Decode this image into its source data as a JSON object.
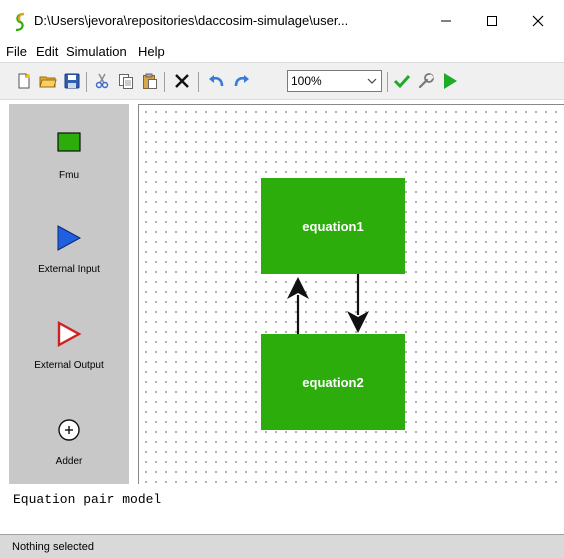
{
  "window": {
    "title": "D:\\Users\\jevora\\repositories\\daccosim-simulage\\user..."
  },
  "menu": [
    "File",
    "Edit",
    "Simulation",
    "Help"
  ],
  "toolbar": {
    "icons": [
      "new-file-icon",
      "open-folder-icon",
      "save-icon",
      "cut-icon",
      "copy-icon",
      "paste-icon",
      "delete-icon",
      "undo-icon",
      "redo-icon",
      "check-icon",
      "settings-wrench-icon",
      "run-icon"
    ],
    "zoom_value": "100%"
  },
  "palette": {
    "items": [
      {
        "label": "Fmu",
        "icon": "fmu-icon"
      },
      {
        "label": "External Input",
        "icon": "external-input-icon"
      },
      {
        "label": "External Output",
        "icon": "external-output-icon"
      },
      {
        "label": "Adder",
        "icon": "adder-icon"
      }
    ]
  },
  "canvas": {
    "nodes": [
      {
        "label": "equation1"
      },
      {
        "label": "equation2"
      }
    ],
    "node_color": "#2cad0c"
  },
  "description": "Equation pair model",
  "status": "Nothing selected"
}
